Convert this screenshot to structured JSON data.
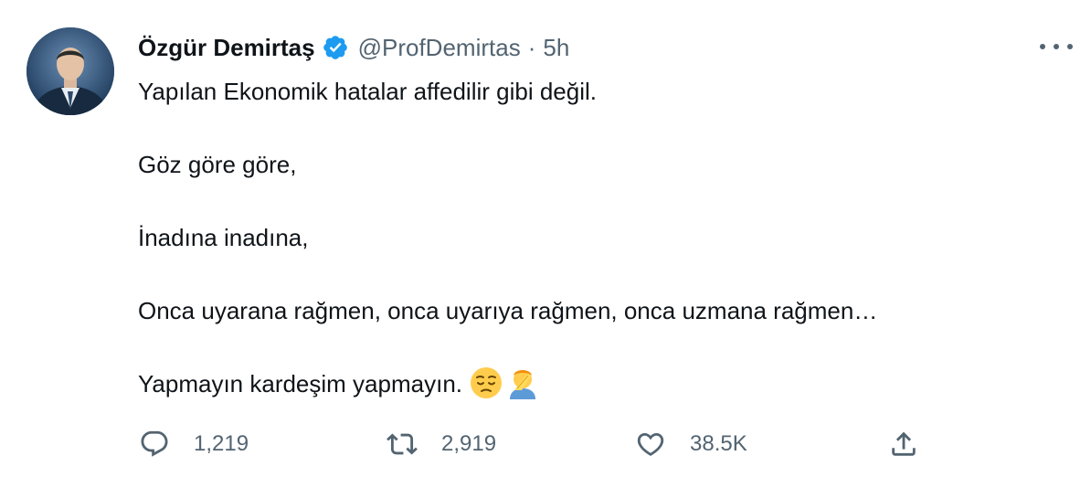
{
  "tweet": {
    "author_name": "Özgür Demirtaş",
    "handle": "@ProfDemirtas",
    "separator": "·",
    "time": "5h",
    "paragraphs": [
      "Yapılan Ekonomik hatalar affedilir gibi değil.",
      "Göz göre göre,",
      "İnadına inadına,",
      "Onca uyarana rağmen, onca uyarıya rağmen, onca uzmana rağmen…",
      "Yapmayın kardeşim yapmayın."
    ],
    "emojis": [
      "pensive-face-icon",
      "facepalm-icon"
    ],
    "actions": {
      "replies": "1,219",
      "retweets": "2,919",
      "likes": "38.5K"
    }
  },
  "colors": {
    "text": "#0f1419",
    "secondary": "#536471",
    "verified": "#1d9bf0"
  }
}
